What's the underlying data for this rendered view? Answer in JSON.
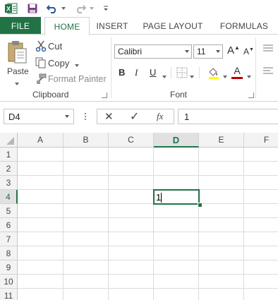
{
  "quick_access": {
    "app_icon": "excel-logo-icon",
    "app_letter": "X",
    "save_icon": "save-icon",
    "undo_icon": "undo-icon",
    "redo_icon": "redo-icon",
    "customize_icon": "customize-qat-icon"
  },
  "tabs": [
    {
      "label": "FILE"
    },
    {
      "label": "HOME"
    },
    {
      "label": "INSERT"
    },
    {
      "label": "PAGE LAYOUT"
    },
    {
      "label": "FORMULAS"
    }
  ],
  "clipboard": {
    "paste_label": "Paste",
    "cut_label": "Cut",
    "copy_label": "Copy",
    "format_painter_label": "Format Painter",
    "group_label": "Clipboard"
  },
  "font": {
    "font_name": "Calibri",
    "font_size": "11",
    "bold": "B",
    "italic": "I",
    "underline": "U",
    "grow": "A",
    "shrink": "A",
    "font_color_letter": "A",
    "group_label": "Font"
  },
  "formula_bar": {
    "name_box": "D4",
    "cancel": "✕",
    "enter": "✓",
    "fx": "fx",
    "value": "1"
  },
  "sheet": {
    "columns": [
      "A",
      "B",
      "C",
      "D",
      "E",
      "F"
    ],
    "rows": [
      "1",
      "2",
      "3",
      "4",
      "5",
      "6",
      "7",
      "8",
      "9",
      "10",
      "11"
    ],
    "active_cell": {
      "column": "D",
      "row": "4",
      "value": "1"
    }
  },
  "colors": {
    "accent": "#217346",
    "file_tab": "#217346",
    "active_header": "#e1e1e1",
    "font_color_bar": "#c00000"
  }
}
